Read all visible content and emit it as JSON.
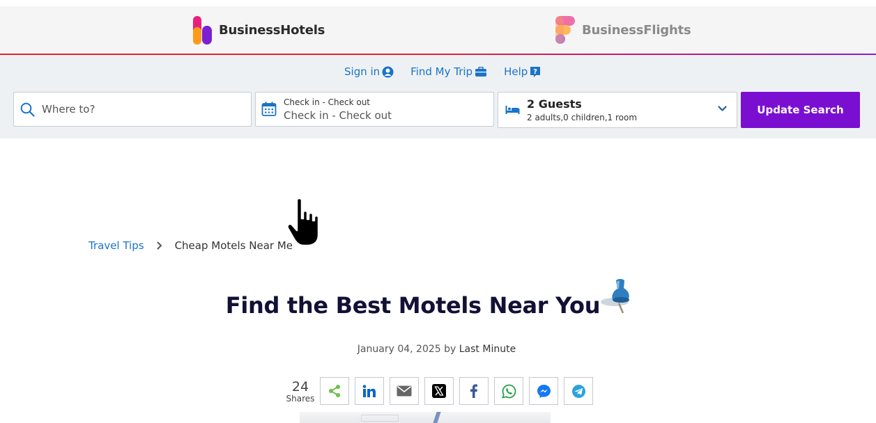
{
  "brands": {
    "hotels": {
      "name": "BusinessHotels"
    },
    "flights": {
      "name": "BusinessFlights"
    }
  },
  "toplinks": {
    "signin": "Sign in",
    "findtrip": "Find My Trip",
    "help": "Help"
  },
  "search": {
    "where_placeholder": "Where to?",
    "dates_label": "Check in - Check out",
    "dates_value": "Check in - Check out",
    "guests_title": "2 Guests",
    "guests_detail": "2 adults,0 children,1 room",
    "update_label": "Update Search"
  },
  "breadcrumb": {
    "parent": "Travel Tips",
    "current": "Cheap Motels Near Me"
  },
  "article": {
    "title": "Find the Best Motels Near You",
    "date": "January 04, 2025",
    "by": "by",
    "author": "Last Minute"
  },
  "shares": {
    "count": "24",
    "label": "Shares",
    "buttons": [
      "share-icon",
      "linkedin-icon",
      "email-icon",
      "x-icon",
      "facebook-icon",
      "whatsapp-icon",
      "messenger-icon",
      "telegram-icon"
    ]
  },
  "colors": {
    "accent_purple": "#7b0fd1",
    "link_blue": "#1a73c8",
    "brand_red": "#e8242a",
    "title_navy": "#111136"
  }
}
